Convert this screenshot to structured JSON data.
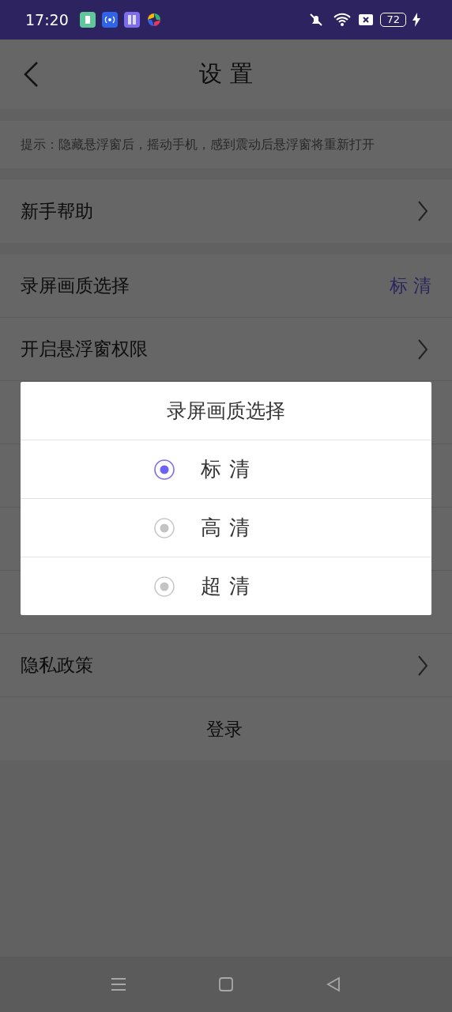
{
  "status_bar": {
    "time": "17:20",
    "battery": "72"
  },
  "header": {
    "title": "设 置"
  },
  "hint": "提示：隐藏悬浮窗后，摇动手机，感到震动后悬浮窗将重新打开",
  "groups": [
    {
      "rows": [
        {
          "label": "新手帮助",
          "kind": "chevron"
        }
      ]
    },
    {
      "rows": [
        {
          "label": "录屏画质选择",
          "kind": "value",
          "value": "标 清"
        },
        {
          "label": "开启悬浮窗权限",
          "kind": "chevron"
        },
        {
          "kind": "covered"
        },
        {
          "kind": "covered"
        },
        {
          "kind": "covered"
        },
        {
          "kind": "covered"
        },
        {
          "label": "隐私政策",
          "kind": "chevron"
        },
        {
          "label": "登录",
          "kind": "center"
        }
      ]
    }
  ],
  "dialog": {
    "title": "录屏画质选择",
    "options": [
      {
        "label": "标 清",
        "selected": true
      },
      {
        "label": "高 清",
        "selected": false
      },
      {
        "label": "超 清",
        "selected": false
      }
    ]
  }
}
